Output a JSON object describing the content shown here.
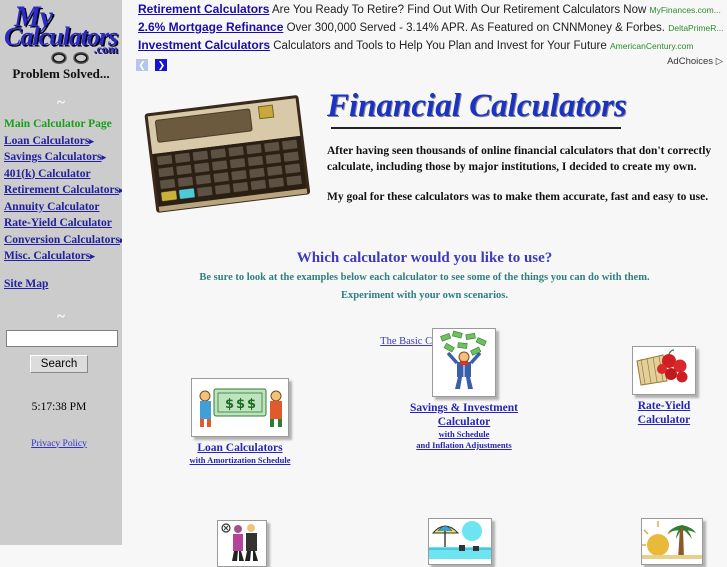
{
  "brand": {
    "logo_line1": "My",
    "logo_line2": "Calculators",
    "logo_dotcom": ".com",
    "tagline": "Problem Solved...",
    "infinity_icon": "infinity-icon"
  },
  "sidebar": {
    "tilde": "~",
    "menu": [
      {
        "label": "Main Calculator Page",
        "color": "#17a017",
        "has_arrow": false
      },
      {
        "label": "Loan Calculators",
        "color": "#2020a0",
        "has_arrow": true
      },
      {
        "label": "Savings Calculators",
        "color": "#2020a0",
        "has_arrow": true
      },
      {
        "label": "401(k) Calculator",
        "color": "#2020a0",
        "has_arrow": false
      },
      {
        "label": "Retirement Calculators",
        "color": "#2020a0",
        "has_arrow": true
      },
      {
        "label": "Annuity Calculator",
        "color": "#2020a0",
        "has_arrow": false
      },
      {
        "label": "Rate-Yield Calculator",
        "color": "#2020a0",
        "has_arrow": false
      },
      {
        "label": "Conversion Calculators",
        "color": "#2020a0",
        "has_arrow": true
      },
      {
        "label": "Misc. Calculators",
        "color": "#2020a0",
        "has_arrow": true
      }
    ],
    "site_map": "Site Map",
    "search_value": "",
    "search_placeholder": "",
    "search_button": "Search",
    "clock": "5:17:38 PM",
    "privacy_policy": "Privacy Policy",
    "arrow_glyph": "▸"
  },
  "ads": {
    "items": [
      {
        "title": "Retirement Calculators",
        "text": "Are You Ready To Retire? Find Out With Our Retirement Calculators Now",
        "domain": "MyFinances.com..."
      },
      {
        "title": "2.6% Mortgage Refinance",
        "text": "Over 300,000 Served - 3.14% APR. As Featured on CNNMoney & Forbes.",
        "domain": "DeltaPrimeR..."
      },
      {
        "title": "Investment Calculators",
        "text": "Calculators and Tools to Help You Plan and Invest for Your Future",
        "domain": "AmericanCentury.com"
      }
    ],
    "prev_glyph": "❮",
    "next_glyph": "❯",
    "adchoices": "AdChoices",
    "adchoices_glyph": "▷"
  },
  "main": {
    "calculator_image": "hp-financial-calculator-image",
    "title": "Financial Calculators",
    "paragraph1": "After having seen thousands of online financial calculators that don't correctly calculate, including those by major institutions, I decided to create my own.",
    "paragraph2": "My goal for these calculators was to make them accurate, fast and easy to use.",
    "which_title": "Which calculator would you like to use?",
    "which_sub1": "Be sure to look at the examples below each calculator to see some of the things you can do with them.",
    "which_sub2": "Experiment with your own scenarios.",
    "basic_calculator_link": "The Basic Calculator",
    "tiles": [
      {
        "id": "loan",
        "label": "Loan Calculators",
        "sub": "with Amortization Schedule",
        "image": "money-bill-people-image"
      },
      {
        "id": "savings",
        "label_line1": "Savings & Investment",
        "label_line2": "Calculator",
        "sub_line1": "with Schedule",
        "sub_line2": "and Inflation Adjustments",
        "image": "man-with-money-image"
      },
      {
        "id": "rate-yield",
        "label_line1": "Rate-Yield",
        "label_line2": "Calculator",
        "image": "basket-of-apples-image"
      },
      {
        "id": "retirement",
        "image": "couple-walking-image"
      },
      {
        "id": "beach",
        "image": "beach-umbrella-image"
      },
      {
        "id": "palm",
        "image": "palm-tree-sunset-image"
      }
    ]
  },
  "colors": {
    "sidebar_bg": "#cccccc",
    "page_bg": "#f7f7f7",
    "link_blue": "#2020a0",
    "green": "#17a017",
    "teal": "#2f7f7f",
    "title_blue": "#1b33c4",
    "ad_link": "#1a0dab",
    "ad_domain": "#2c8a2c"
  }
}
